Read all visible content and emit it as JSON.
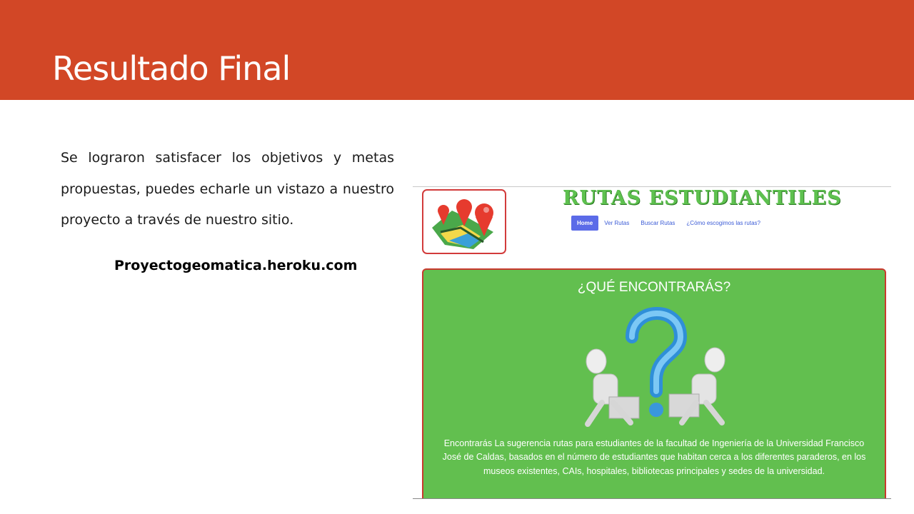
{
  "slide": {
    "title": "Resultado Final",
    "body": "Se lograron satisfacer los objetivos y metas propuestas, puedes echarle un vistazo a nuestro proyecto a través de nuestro sitio.",
    "link_text": "Proyectogeomatica.heroku.com"
  },
  "website": {
    "title": "RUTAS ESTUDIANTILES",
    "nav": [
      "Home",
      "Ver Rutas",
      "Buscar Rutas",
      "¿Cómo escogimos las rutas?"
    ],
    "panel_heading": "¿QUÉ ENCONTRARÁS?",
    "panel_text": "Encontrarás La sugerencia rutas para estudiantes de la facultad de Ingeniería de la Universidad Francisco José de Caldas, basados en el número de estudiantes que habitan cerca a los diferentes paraderos, en los museos existentes, CAIs, hospitales, bibliotecas principales y sedes de la universidad."
  },
  "colors": {
    "header": "#D24726",
    "site_green": "#62bf4f",
    "panel_border": "#c9392e",
    "nav_active": "#5b6be8"
  }
}
